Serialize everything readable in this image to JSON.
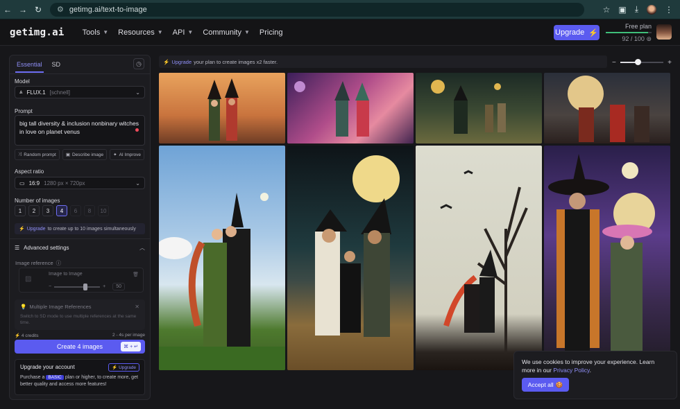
{
  "browser": {
    "url": "getimg.ai/text-to-image"
  },
  "header": {
    "logo": "getimg.ai",
    "nav": [
      {
        "label": "Tools",
        "dropdown": true
      },
      {
        "label": "Resources",
        "dropdown": true
      },
      {
        "label": "API",
        "dropdown": true
      },
      {
        "label": "Community",
        "dropdown": true
      },
      {
        "label": "Pricing",
        "dropdown": false
      }
    ],
    "upgrade_label": "Upgrade",
    "plan_name": "Free plan",
    "credits_used": 92,
    "credits_total": 100,
    "credits_text": "92 / 100"
  },
  "panel": {
    "tabs": [
      "Essential",
      "SD"
    ],
    "active_tab": "Essential",
    "model_label": "Model",
    "model_value": "FLUX.1",
    "model_variant": "[schnell]",
    "prompt_label": "Prompt",
    "prompt_text": "big tall diversity & inclusion nonbinary witches in love on planet venus",
    "prompt_tools": [
      "Random prompt",
      "Describe image",
      "AI Improve"
    ],
    "aspect_label": "Aspect ratio",
    "aspect_value": "16:9",
    "aspect_size": "1280 px × 720px",
    "num_label": "Number of images",
    "num_options": [
      "1",
      "2",
      "3",
      "4",
      "6",
      "8",
      "10"
    ],
    "num_selected": "4",
    "num_hint_link": "Upgrade",
    "num_hint_text": "to create up to 10 images simultaneously",
    "advanced_label": "Advanced settings",
    "image_ref_label": "Image reference",
    "image_to_image_label": "Image to Image",
    "image_ref_strength": "50",
    "multi_ref_title": "Multiple Image References",
    "multi_ref_desc": "Switch to SD mode to use multiple references at the same time.",
    "credits_cost": "4 credits",
    "time_estimate": "2 - 4s per image",
    "create_label": "Create 4 images",
    "shortcut": "⌘ + ↵",
    "upgrade_card_title": "Upgrade your account",
    "upgrade_chip": "Upgrade",
    "upgrade_desc_pre": "Purchase a",
    "upgrade_desc_tag": "BASIC",
    "upgrade_desc_post": "plan or higher, to create more, get better quality and access more features!"
  },
  "main": {
    "banner_link": "Upgrade",
    "banner_text": "your plan to create images x2 faster.",
    "zoom_level": 0.4,
    "images": [
      "witch-couple-orange",
      "witch-couple-pink",
      "witches-moon-field",
      "witches-full-moon",
      "witch-kiss-blue-sky",
      "witch-family-moon",
      "witches-bare-tree",
      "witch-couple-purple"
    ]
  },
  "cookie": {
    "text": "We use cookies to improve your experience. Learn more in our",
    "link": "Privacy Policy",
    "accept_label": "Accept all"
  },
  "colors": {
    "accent": "#5b5bf0",
    "background": "#17171a",
    "panel": "#1c1c20"
  }
}
